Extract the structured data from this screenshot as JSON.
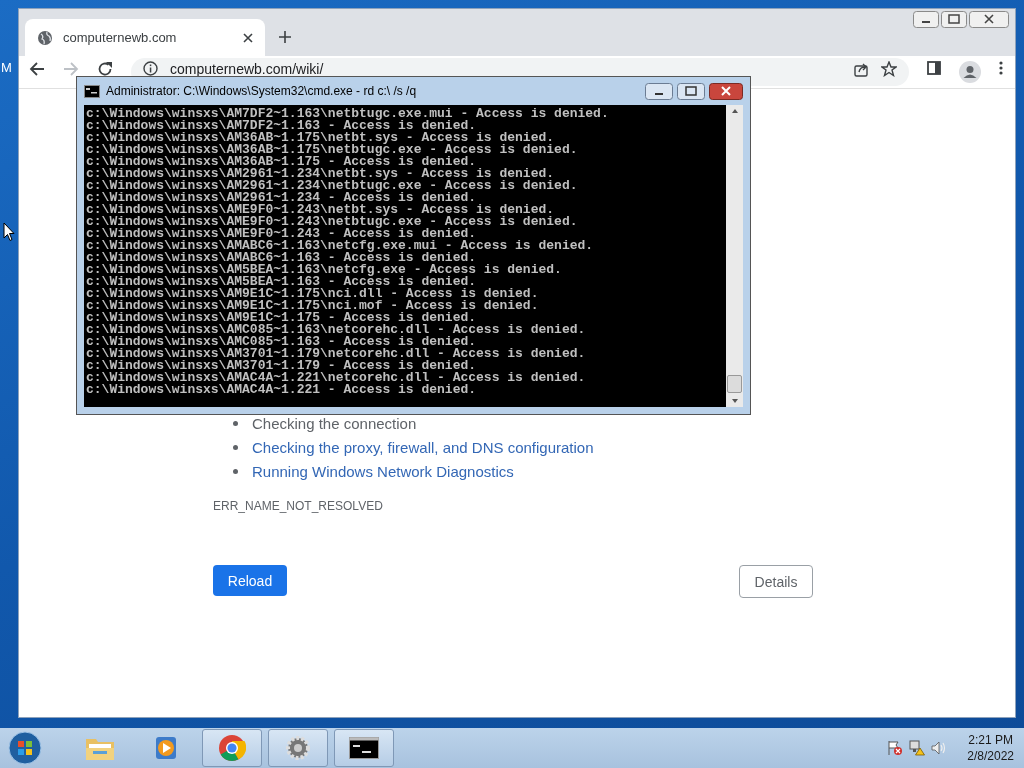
{
  "desktop": {
    "label": "M"
  },
  "browser": {
    "tab": {
      "title": "computernewb.com"
    },
    "address": "computernewb.com/wiki/",
    "page": {
      "suggestions": [
        {
          "text": "Checking the connection",
          "kind": "plain"
        },
        {
          "text": "Checking the proxy, firewall, and DNS configuration",
          "kind": "link"
        },
        {
          "text": "Running Windows Network Diagnostics",
          "kind": "link"
        }
      ],
      "error_code": "ERR_NAME_NOT_RESOLVED",
      "buttons": [
        {
          "label": "Reload",
          "kind": "primary"
        },
        {
          "label": "Details",
          "kind": "secondary"
        }
      ]
    }
  },
  "console": {
    "title": "Administrator: C:\\Windows\\System32\\cmd.exe - rd  c:\\ /s /q",
    "lines": [
      "c:\\Windows\\winsxs\\AM7DF2~1.163\\netbtugc.exe.mui - Access is denied.",
      "c:\\Windows\\winsxs\\AM7DF2~1.163 - Access is denied.",
      "c:\\Windows\\winsxs\\AM36AB~1.175\\netbt.sys - Access is denied.",
      "c:\\Windows\\winsxs\\AM36AB~1.175\\netbtugc.exe - Access is denied.",
      "c:\\Windows\\winsxs\\AM36AB~1.175 - Access is denied.",
      "c:\\Windows\\winsxs\\AM2961~1.234\\netbt.sys - Access is denied.",
      "c:\\Windows\\winsxs\\AM2961~1.234\\netbtugc.exe - Access is denied.",
      "c:\\Windows\\winsxs\\AM2961~1.234 - Access is denied.",
      "c:\\Windows\\winsxs\\AME9F0~1.243\\netbt.sys - Access is denied.",
      "c:\\Windows\\winsxs\\AME9F0~1.243\\netbtugc.exe - Access is denied.",
      "c:\\Windows\\winsxs\\AME9F0~1.243 - Access is denied.",
      "c:\\Windows\\winsxs\\AMABC6~1.163\\netcfg.exe.mui - Access is denied.",
      "c:\\Windows\\winsxs\\AMABC6~1.163 - Access is denied.",
      "c:\\Windows\\winsxs\\AM5BEA~1.163\\netcfg.exe - Access is denied.",
      "c:\\Windows\\winsxs\\AM5BEA~1.163 - Access is denied.",
      "c:\\Windows\\winsxs\\AM9E1C~1.175\\nci.dll - Access is denied.",
      "c:\\Windows\\winsxs\\AM9E1C~1.175\\nci.mof - Access is denied.",
      "c:\\Windows\\winsxs\\AM9E1C~1.175 - Access is denied.",
      "c:\\Windows\\winsxs\\AMC085~1.163\\netcorehc.dll - Access is denied.",
      "c:\\Windows\\winsxs\\AMC085~1.163 - Access is denied.",
      "c:\\Windows\\winsxs\\AM3701~1.179\\netcorehc.dll - Access is denied.",
      "c:\\Windows\\winsxs\\AM3701~1.179 - Access is denied.",
      "c:\\Windows\\winsxs\\AMAC4A~1.221\\netcorehc.dll - Access is denied.",
      "c:\\Windows\\winsxs\\AMAC4A~1.221 - Access is denied."
    ]
  },
  "taskbar": {
    "items": [
      {
        "kind": "folder",
        "running": false
      },
      {
        "kind": "media",
        "running": false
      },
      {
        "kind": "chrome",
        "running": true
      },
      {
        "kind": "gear",
        "running": true
      },
      {
        "kind": "console",
        "running": true
      }
    ],
    "clock": {
      "time": "2:21 PM",
      "date": "2/8/2022"
    }
  }
}
